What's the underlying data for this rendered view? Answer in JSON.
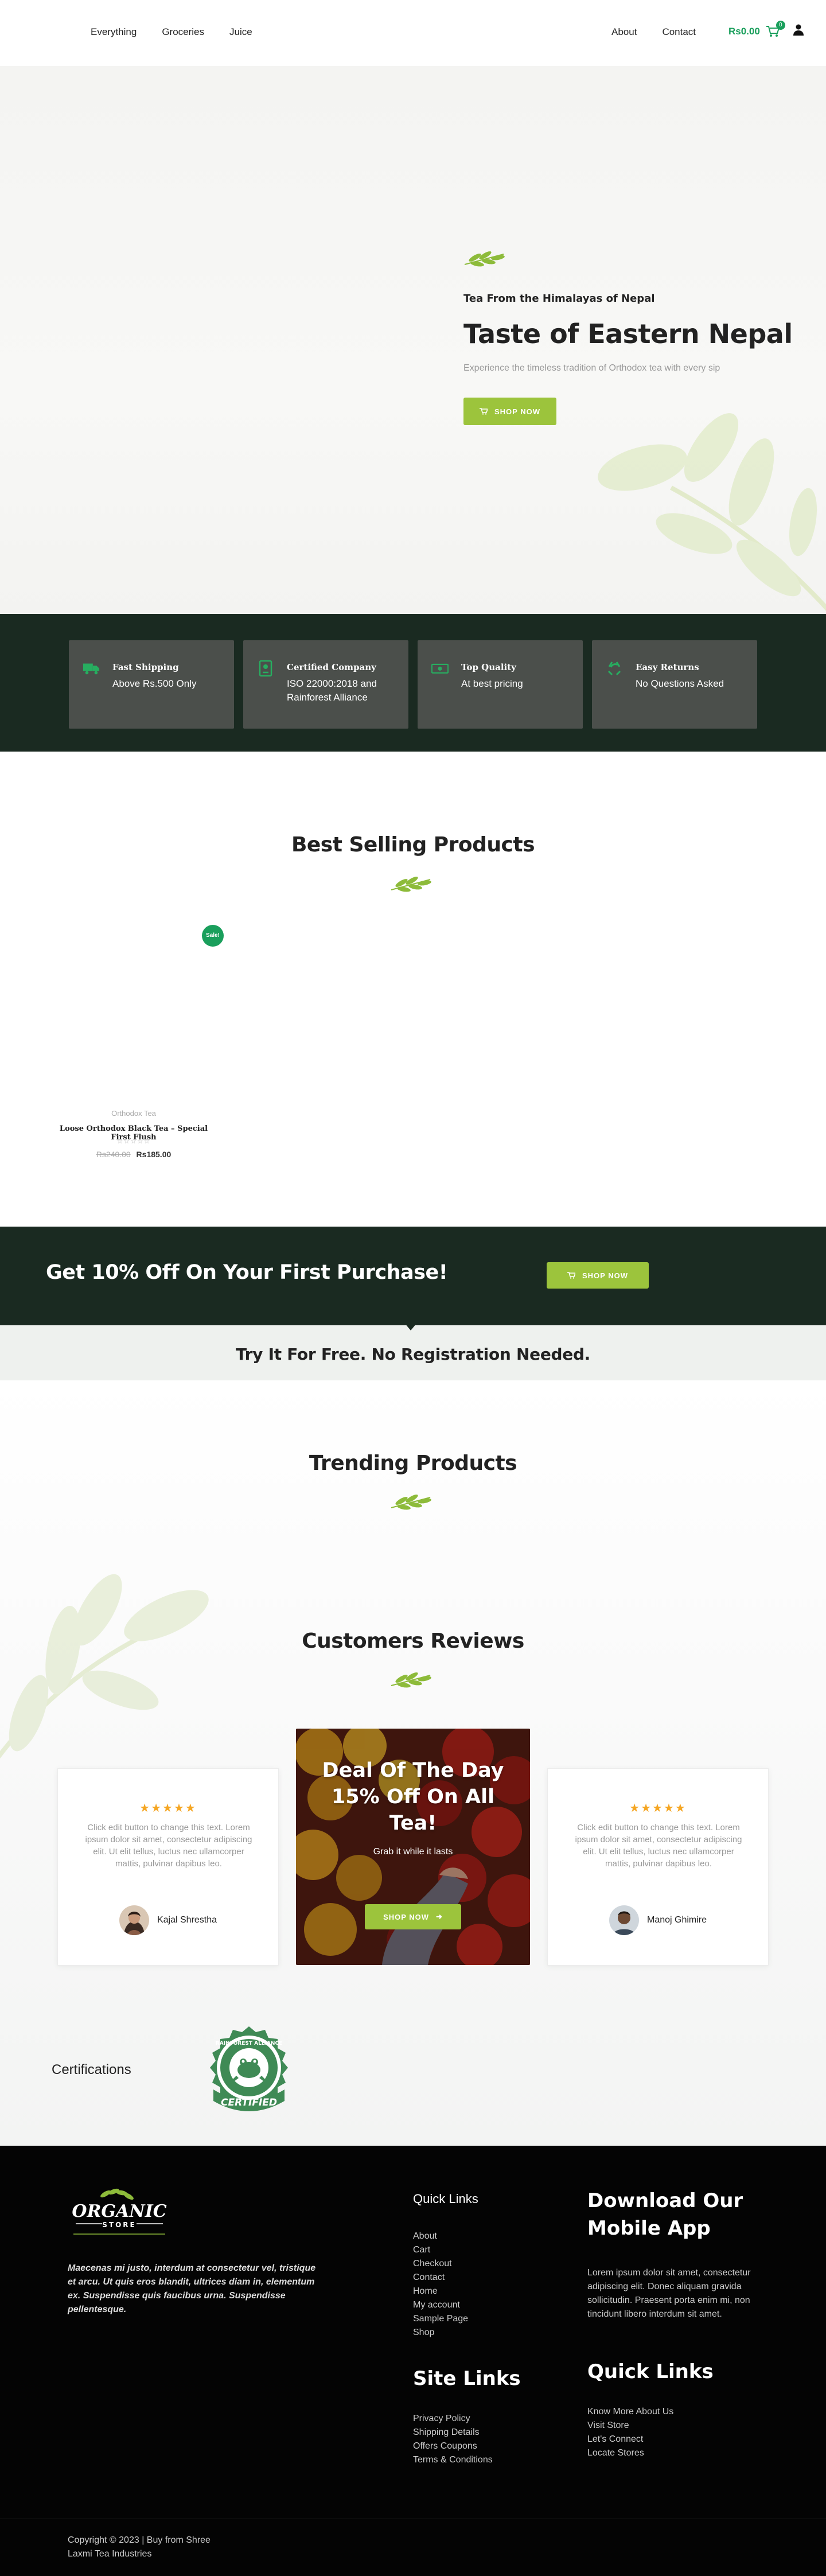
{
  "header": {
    "nav_left": [
      "Everything",
      "Groceries",
      "Juice"
    ],
    "nav_right": [
      "About",
      "Contact"
    ],
    "cart_total": "Rs0.00",
    "cart_count": "0"
  },
  "hero": {
    "subtitle": "Tea From the Himalayas of Nepal",
    "title": "Taste of Eastern Nepal",
    "description": "Experience the timeless tradition of Orthodox tea with every sip",
    "button": "SHOP NOW"
  },
  "features": [
    {
      "icon": "truck-icon",
      "title": "Fast Shipping",
      "text": "Above Rs.500 Only"
    },
    {
      "icon": "certificate-icon",
      "title": "Certified Company",
      "text": "ISO 22000:2018 and Rainforest Alliance"
    },
    {
      "icon": "money-icon",
      "title": "Top Quality",
      "text": "At best pricing"
    },
    {
      "icon": "recycle-icon",
      "title": "Easy Returns",
      "text": "No Questions Asked"
    }
  ],
  "best_selling": {
    "title": "Best Selling Products",
    "sale_badge": "Sale!",
    "product": {
      "category": "Orthodox Tea",
      "name": "Loose Orthodox Black Tea – Special First Flush",
      "stars": "☆☆☆☆☆",
      "old_price": "Rs240.00",
      "price": "Rs185.00"
    }
  },
  "promo": {
    "title": "Get 10% Off On Your First Purchase!",
    "button": "SHOP NOW",
    "try_text": "Try It For Free. No Registration Needed."
  },
  "trending": {
    "title": "Trending Products"
  },
  "reviews": {
    "title": "Customers Reviews",
    "items": [
      {
        "stars": "★★★★★",
        "text": "Click edit button to change this text. Lorem ipsum dolor sit amet, consectetur adipiscing elit. Ut elit tellus, luctus nec ullamcorper mattis, pulvinar dapibus leo.",
        "author": "Kajal Shrestha"
      },
      {
        "stars": "★★★★★",
        "text": "Click edit button to change this text. Lorem ipsum dolor sit amet, consectetur adipiscing elit. Ut elit tellus, luctus nec ullamcorper mattis, pulvinar dapibus leo.",
        "author": "Manoj Ghimire"
      }
    ],
    "deal": {
      "title_line1": "Deal Of The Day",
      "title_line2": "15% Off On All",
      "title_line3": "Tea!",
      "subtitle": "Grab it while it lasts",
      "button": "SHOP NOW"
    }
  },
  "certifications": {
    "label": "Certifications",
    "seal_text_top": "RAINFOREST ALLIANCE",
    "seal_text_bottom": "CERTIFIED"
  },
  "footer": {
    "logo_main": "ORGANIC",
    "logo_sub": "STORE",
    "description": "Maecenas mi justo, interdum at consectetur vel, tristique et arcu. Ut quis eros blandit, ultrices diam in, elementum ex. Suspendisse quis faucibus urna. Suspendisse pellentesque.",
    "quick_links_title": "Quick Links",
    "quick_links": [
      "About",
      "Cart",
      "Checkout",
      "Contact",
      "Home",
      "My account",
      "Sample Page",
      "Shop"
    ],
    "site_links_title": "Site Links",
    "site_links": [
      "Privacy Policy",
      "Shipping Details",
      "Offers Coupons",
      "Terms & Conditions"
    ],
    "app_title_line1": "Download Our",
    "app_title_line2": "Mobile App",
    "app_text": "Lorem ipsum dolor sit amet, consectetur adipiscing elit. Donec aliquam gravida sollicitudin. Praesent porta enim mi, non tincidunt libero interdum sit amet.",
    "quick_links2_title": "Quick Links",
    "quick_links2": [
      "Know More About Us",
      "Visit Store",
      "Let's Connect",
      "Locate Stores"
    ],
    "copyright_line1": "Copyright © 2023 | Buy from Shree",
    "copyright_line2": "Laxmi Tea Industries"
  },
  "colors": {
    "accent_green": "#9cc43c",
    "brand_green": "#1a9f5c",
    "dark_band": "#1a2a21",
    "star_color": "#f5a623"
  }
}
